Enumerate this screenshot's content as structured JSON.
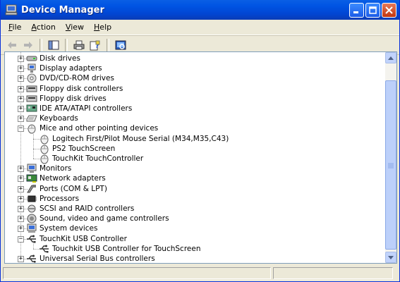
{
  "window": {
    "title": "Device Manager"
  },
  "menu": [
    {
      "label": "File",
      "key": "F",
      "rest": "ile"
    },
    {
      "label": "Action",
      "key": "A",
      "rest": "ction"
    },
    {
      "label": "View",
      "key": "V",
      "rest": "iew"
    },
    {
      "label": "Help",
      "key": "H",
      "rest": "elp"
    }
  ],
  "tree": [
    {
      "label": "Disk drives",
      "icon": "disk-drive-icon",
      "level": 1,
      "expander": "+"
    },
    {
      "label": "Display adapters",
      "icon": "display-adapter-icon",
      "level": 1,
      "expander": "+"
    },
    {
      "label": "DVD/CD-ROM drives",
      "icon": "cdrom-icon",
      "level": 1,
      "expander": "+"
    },
    {
      "label": "Floppy disk controllers",
      "icon": "floppy-controller-icon",
      "level": 1,
      "expander": "+"
    },
    {
      "label": "Floppy disk drives",
      "icon": "floppy-drive-icon",
      "level": 1,
      "expander": "+"
    },
    {
      "label": "IDE ATA/ATAPI controllers",
      "icon": "ide-controller-icon",
      "level": 1,
      "expander": "+"
    },
    {
      "label": "Keyboards",
      "icon": "keyboard-icon",
      "level": 1,
      "expander": "+"
    },
    {
      "label": "Mice and other pointing devices",
      "icon": "mouse-icon",
      "level": 1,
      "expander": "-"
    },
    {
      "label": "Logitech First/Pilot Mouse Serial (M34,M35,C43)",
      "icon": "mouse-icon",
      "level": 2,
      "expander": ""
    },
    {
      "label": "PS2 TouchScreen",
      "icon": "mouse-icon",
      "level": 2,
      "expander": ""
    },
    {
      "label": "TouchKit TouchController",
      "icon": "mouse-icon",
      "level": 2,
      "expander": ""
    },
    {
      "label": "Monitors",
      "icon": "monitor-icon",
      "level": 1,
      "expander": "+"
    },
    {
      "label": "Network adapters",
      "icon": "network-adapter-icon",
      "level": 1,
      "expander": "+"
    },
    {
      "label": "Ports (COM & LPT)",
      "icon": "port-icon",
      "level": 1,
      "expander": "+"
    },
    {
      "label": "Processors",
      "icon": "processor-icon",
      "level": 1,
      "expander": "+"
    },
    {
      "label": "SCSI and RAID controllers",
      "icon": "scsi-icon",
      "level": 1,
      "expander": "+"
    },
    {
      "label": "Sound, video and game controllers",
      "icon": "sound-icon",
      "level": 1,
      "expander": "+"
    },
    {
      "label": "System devices",
      "icon": "system-device-icon",
      "level": 1,
      "expander": "+"
    },
    {
      "label": "TouchKit USB Controller",
      "icon": "usb-icon",
      "level": 1,
      "expander": "-"
    },
    {
      "label": "Touchkit USB Controller for TouchScreen",
      "icon": "usb-icon",
      "level": 2,
      "expander": ""
    },
    {
      "label": "Universal Serial Bus controllers",
      "icon": "usb-icon",
      "level": 1,
      "expander": "+"
    }
  ]
}
